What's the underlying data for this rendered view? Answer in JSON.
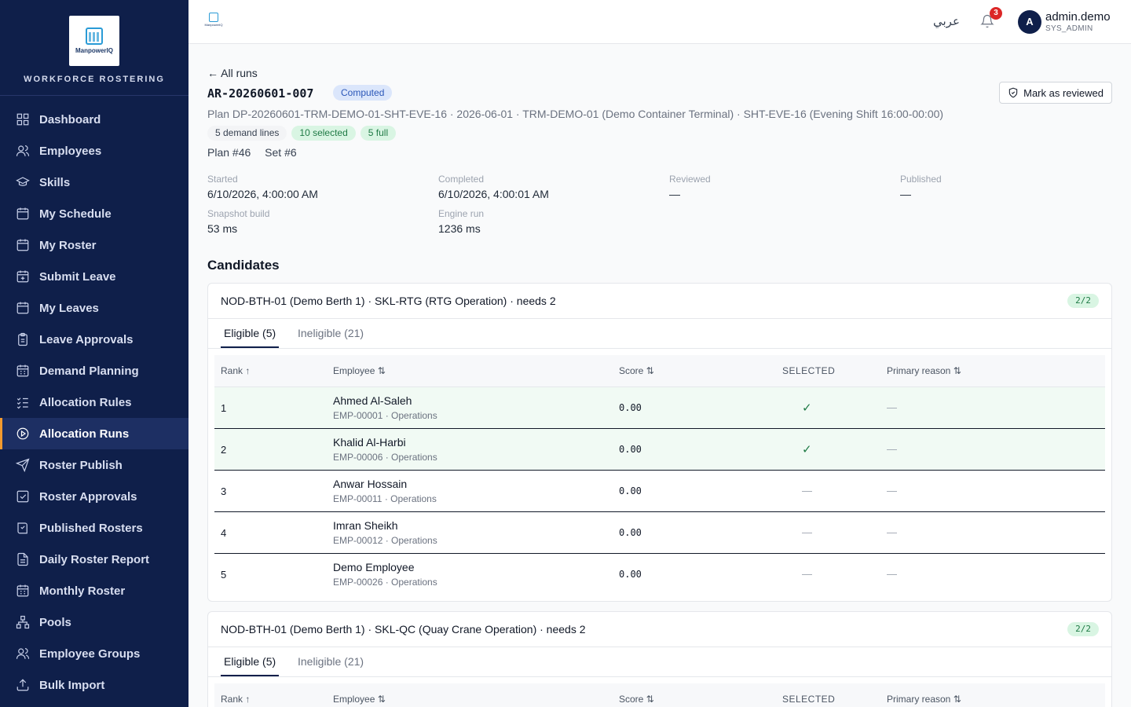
{
  "brand": {
    "logo_text": "ManpowerIQ",
    "title": "WORKFORCE ROSTERING"
  },
  "nav": [
    {
      "label": "Dashboard",
      "icon": "dashboard-icon"
    },
    {
      "label": "Employees",
      "icon": "users-icon"
    },
    {
      "label": "Skills",
      "icon": "graduation-cap-icon"
    },
    {
      "label": "My Schedule",
      "icon": "calendar-icon"
    },
    {
      "label": "My Roster",
      "icon": "calendar-icon"
    },
    {
      "label": "Submit Leave",
      "icon": "calendar-plus-icon"
    },
    {
      "label": "My Leaves",
      "icon": "calendar-icon"
    },
    {
      "label": "Leave Approvals",
      "icon": "clipboard-icon"
    },
    {
      "label": "Demand Planning",
      "icon": "calendar-grid-icon"
    },
    {
      "label": "Allocation Rules",
      "icon": "list-check-icon"
    },
    {
      "label": "Allocation Runs",
      "icon": "play-circle-icon",
      "active": true
    },
    {
      "label": "Roster Publish",
      "icon": "send-icon"
    },
    {
      "label": "Roster Approvals",
      "icon": "check-square-icon"
    },
    {
      "label": "Published Rosters",
      "icon": "book-check-icon"
    },
    {
      "label": "Daily Roster Report",
      "icon": "file-text-icon"
    },
    {
      "label": "Monthly Roster",
      "icon": "calendar-grid-icon"
    },
    {
      "label": "Pools",
      "icon": "network-icon"
    },
    {
      "label": "Employee Groups",
      "icon": "users-icon"
    },
    {
      "label": "Bulk Import",
      "icon": "upload-icon"
    }
  ],
  "topbar": {
    "logo_text": "ManpowerIQ",
    "language": "عربي",
    "notifications": "3",
    "avatar_initial": "A",
    "user_name": "admin.demo",
    "user_role": "SYS_ADMIN"
  },
  "run": {
    "back_label": "← All runs",
    "id": "AR-20260601-007",
    "status": "Computed",
    "review_label": "Mark as reviewed",
    "plan_line": "Plan DP-20260601-TRM-DEMO-01-SHT-EVE-16 · 2026-06-01 · TRM-DEMO-01 (Demo Container Terminal) · SHT-EVE-16 (Evening Shift 16:00-00:00)",
    "chips": [
      "5 demand lines",
      "10 selected",
      "5 full"
    ],
    "plan_no": "Plan #46",
    "set_no": "Set #6",
    "meta": {
      "started_label": "Started",
      "started": "6/10/2026, 4:00:00 AM",
      "completed_label": "Completed",
      "completed": "6/10/2026, 4:00:01 AM",
      "reviewed_label": "Reviewed",
      "reviewed": "—",
      "published_label": "Published",
      "published": "—",
      "snapshot_label": "Snapshot build",
      "snapshot": "53 ms",
      "engine_label": "Engine run",
      "engine": "1236 ms"
    }
  },
  "candidates": {
    "title": "Candidates",
    "columns": {
      "rank": "Rank ↑",
      "employee": "Employee ⇅",
      "score": "Score ⇅",
      "selected": "SELECTED",
      "reason": "Primary reason ⇅"
    },
    "cards": [
      {
        "title": "NOD-BTH-01 (Demo Berth 1) · SKL-RTG (RTG Operation) · needs 2",
        "count": "2/2",
        "tab_eligible": "Eligible (5)",
        "tab_ineligible": "Ineligible (21)",
        "rows": [
          {
            "rank": "1",
            "name": "Ahmed Al-Saleh",
            "sub": "EMP-00001 · Operations",
            "score": "0.00",
            "selected": "✓",
            "reason": "—"
          },
          {
            "rank": "2",
            "name": "Khalid Al-Harbi",
            "sub": "EMP-00006 · Operations",
            "score": "0.00",
            "selected": "✓",
            "reason": "—"
          },
          {
            "rank": "3",
            "name": "Anwar Hossain",
            "sub": "EMP-00011 · Operations",
            "score": "0.00",
            "selected": "—",
            "reason": "—"
          },
          {
            "rank": "4",
            "name": "Imran Sheikh",
            "sub": "EMP-00012 · Operations",
            "score": "0.00",
            "selected": "—",
            "reason": "—"
          },
          {
            "rank": "5",
            "name": "Demo Employee",
            "sub": "EMP-00026 · Operations",
            "score": "0.00",
            "selected": "—",
            "reason": "—"
          }
        ]
      },
      {
        "title": "NOD-BTH-01 (Demo Berth 1) · SKL-QC (Quay Crane Operation) · needs 2",
        "count": "2/2",
        "tab_eligible": "Eligible (5)",
        "tab_ineligible": "Ineligible (21)",
        "rows": []
      }
    ]
  }
}
